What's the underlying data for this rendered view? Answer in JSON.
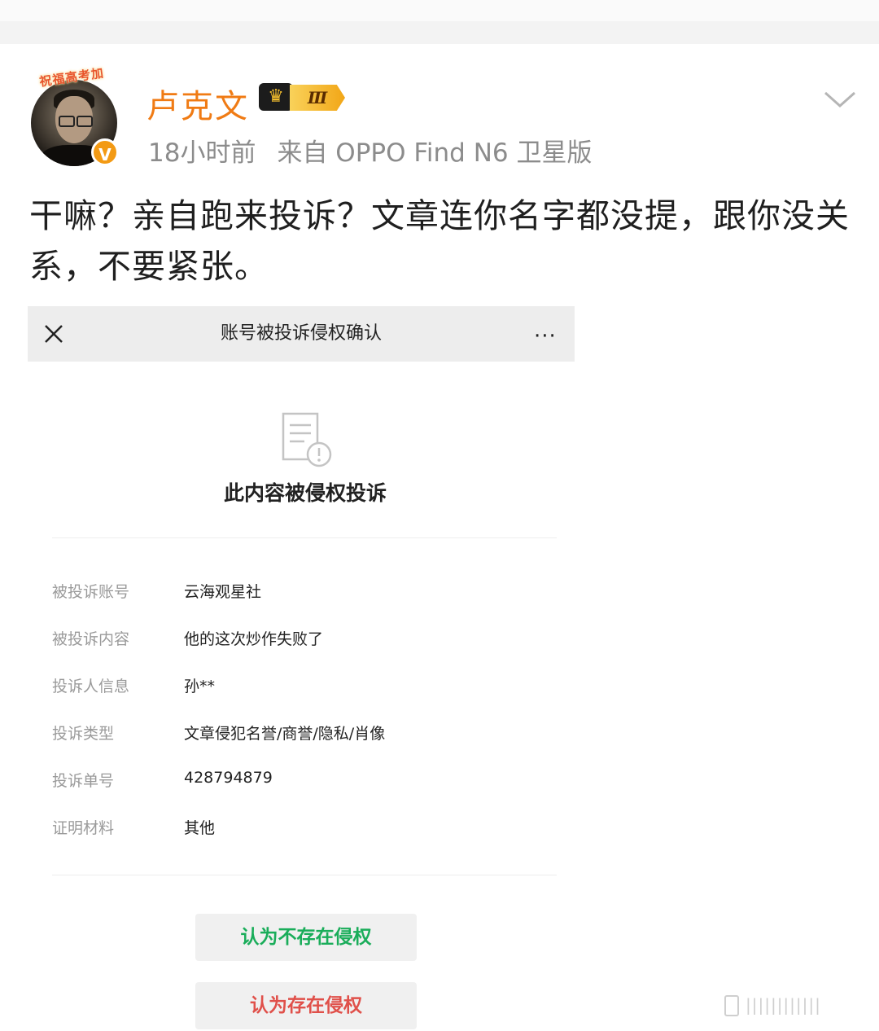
{
  "post": {
    "avatar_banner": "祝福高考加",
    "username": "卢克文",
    "level_badge": "Ⅲ",
    "time": "18小时前",
    "source": "来自 OPPO Find N6 卫星版",
    "text": "干嘛？亲自跑来投诉？文章连你名字都没提，跟你没关系，不要紧张。"
  },
  "embedded_screenshot": {
    "title": "账号被投诉侵权确认",
    "more": "···",
    "status": "此内容被侵权投诉",
    "fields": [
      {
        "label": "被投诉账号",
        "value": "云海观星社"
      },
      {
        "label": "被投诉内容",
        "value": "他的这次炒作失败了"
      },
      {
        "label": "投诉人信息",
        "value": "孙**"
      },
      {
        "label": "投诉类型",
        "value": "文章侵犯名誉/商誉/隐私/肖像"
      },
      {
        "label": "投诉单号",
        "value": "428794879"
      },
      {
        "label": "证明材料",
        "value": "其他"
      }
    ],
    "button_no_infringement": "认为不存在侵权",
    "button_infringement": "认为存在侵权"
  },
  "colors": {
    "username": "#f07b14",
    "verified": "#f39a14",
    "green_button_text": "#1aad5a",
    "red_button_text": "#e0504a"
  },
  "icons": [
    "crown-icon",
    "verified-badge",
    "chevron-down-icon",
    "close-icon",
    "more-icon",
    "doc-warning-icon"
  ]
}
